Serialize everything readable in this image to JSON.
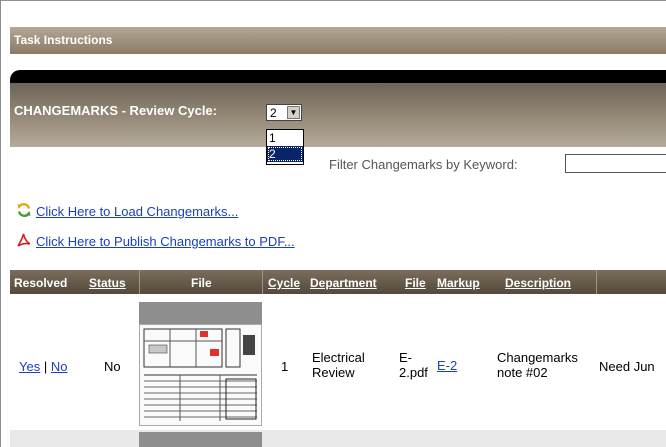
{
  "task": {
    "title": "Task Instructions"
  },
  "changemarks": {
    "title": "CHANGEMARKS - Review Cycle:",
    "cycle_selected": "2",
    "cycle_options": [
      "1",
      "2"
    ],
    "filter_label": "Filter Changemarks by Keyword:",
    "filter_value": ""
  },
  "links": {
    "load": "Click Here to Load Changemarks...",
    "publish": "Click Here to Publish Changemarks to PDF..."
  },
  "table": {
    "headers": {
      "resolved": "Resolved",
      "status": "Status",
      "file_preview": "File",
      "cycle": "Cycle",
      "department": "Department",
      "file": "File",
      "markup": "Markup",
      "description": "Description"
    },
    "rows": [
      {
        "resolved_yes": "Yes",
        "resolved_sep": "|",
        "resolved_no": "No",
        "status": "No",
        "cycle": "1",
        "department_line1": "Electrical",
        "department_line2": "Review",
        "file_line1": "E-",
        "file_line2": "2.pdf",
        "markup": "E-2",
        "description_line1": "Changemarks",
        "description_line2": "note #02",
        "extra": "Need Jun"
      }
    ]
  },
  "colors": {
    "header_brown": "#8b7b66",
    "link_blue": "#1a3fbf",
    "selection_blue": "#0a246a"
  },
  "icons": {
    "reload": "refresh-icon",
    "pdf": "pdf-icon"
  }
}
